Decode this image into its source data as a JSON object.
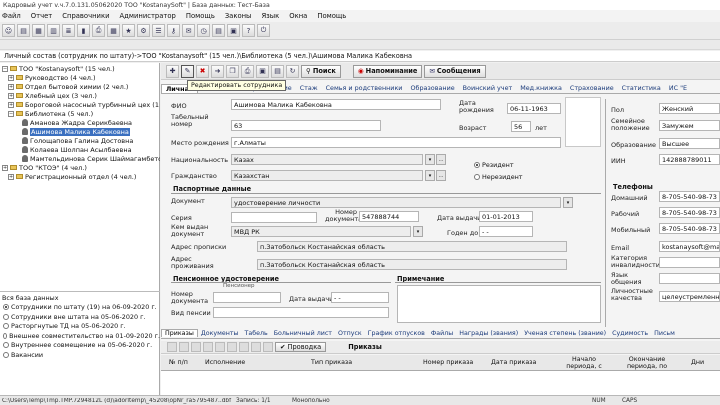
{
  "window": {
    "title": "Кадровый учет v.ч.7.0.131.05062020 ТОО \"KostanaySoft\" | База данных: Тест-База"
  },
  "menu": [
    "Файл",
    "Отчет",
    "Справочники",
    "Администратор",
    "Помощь",
    "Законы",
    "Язык",
    "Окна",
    "Помощь"
  ],
  "breadcrumb": "Личный состав (сотрудник по штату)->ТОО \"Kostanaysoft\" (15 чел.)\\Библиотека (5 чел.)\\Ашимова Малика Кабековна",
  "tree": {
    "items": [
      {
        "label": "ТОО \"Kostanaysoft\" (15 чел.)",
        "box": "−",
        "icon": "f"
      },
      {
        "label": "Руководство (4 чел.)",
        "box": "+",
        "icon": "f"
      },
      {
        "label": "Отдел бытовой химии (2 чел.)",
        "box": "+",
        "icon": "f"
      },
      {
        "label": "Хлебный цех (3 чел.)",
        "box": "+",
        "icon": "f"
      },
      {
        "label": "Бороговой насосный турбинный цех (1 чел.)",
        "box": "+",
        "icon": "f"
      },
      {
        "label": "Библиотека (5 чел.)",
        "box": "−",
        "icon": "f"
      },
      {
        "label": "Аманова Жадра Серикбаевна",
        "box": "",
        "icon": "p"
      },
      {
        "label": "Ашимова Малика Кабековна",
        "box": "",
        "icon": "p",
        "selected": true
      },
      {
        "label": "Голощапова Галина Достовна",
        "box": "",
        "icon": "p"
      },
      {
        "label": "Колаева Шолпан Асылбаевна",
        "box": "",
        "icon": "p"
      },
      {
        "label": "Мамтельдинова Серик Шаймагамбетович",
        "box": "",
        "icon": "p"
      },
      {
        "label": "ТОО \"КТОЭ\" (4 чел.)",
        "box": "+",
        "icon": "f"
      },
      {
        "label": "Регистрационный отдел (4 чел.)",
        "box": "+",
        "icon": "f"
      }
    ]
  },
  "filters": {
    "header": "Вся база данных",
    "options": [
      {
        "label": "Сотрудники по штату (19) на 06-09-2020 г.",
        "on": true
      },
      {
        "label": "Сотрудники вне штата на 05-06-2020 г.",
        "on": false
      },
      {
        "label": "Расторгнутые ТД на 05-06-2020 г.",
        "on": false
      },
      {
        "label": "Внешнее совместительство на 01-09-2020 г.",
        "on": false
      },
      {
        "label": "Внутреннее совмещение на 05-06-2020 г.",
        "on": false
      },
      {
        "label": "Вакансии",
        "on": false
      }
    ]
  },
  "toolbar": {
    "search": "Поиск",
    "reminder": "Напоминание",
    "messages": "Сообщения",
    "tooltip": "Редактировать сотрудника"
  },
  "tabs": [
    "Личная",
    "Перемещение",
    "Стаж",
    "Семья и родственники",
    "Образование",
    "Воинский учет",
    "Мед.книжка",
    "Страхование",
    "Статистика",
    "ИС \"Е"
  ],
  "person": {
    "fio_label": "ФИО",
    "fio": "Ашимова Малика Кабековна",
    "tabnum_label": "Табельный номер",
    "tabnum": "63",
    "birthdate_label": "Дата рождения",
    "birthdate": "06-11-1963",
    "age_label": "Возраст",
    "age": "56",
    "age_unit": "лет",
    "birthplace_label": "Место рождения",
    "birthplace": "г.Алматы",
    "nationality_label": "Национальность",
    "nationality": "Казах",
    "citizenship_label": "Гражданство",
    "citizenship": "Казахстан",
    "resident": "Резидент",
    "nonresident": "Нерезидент",
    "gender_label": "Пол",
    "gender": "Женский",
    "marital_label": "Семейное положение",
    "marital": "Замужем",
    "education_label": "Образование",
    "education": "Высшее",
    "iin_label": "ИИН",
    "iin": "142888789011"
  },
  "passport": {
    "header": "Паспортные данные",
    "doc_label": "Документ",
    "doc": "удостоверение личности",
    "series_label": "Серия",
    "number_label": "Номер документа",
    "number": "547888744",
    "issuedate_label": "Дата выдачи",
    "issuedate": "01-01-2013",
    "issuer_label": "Кем выдан документ",
    "issuer": "МВД РК",
    "valid_label": "Годен до",
    "valid": "- -",
    "reg_label": "Адрес прописки",
    "reg": "п.Затобольск Костанайская область",
    "live_label": "Адрес проживания",
    "live": "п.Затобольск Костанайская область"
  },
  "pension": {
    "header": "Пенсионное удостоверение",
    "sub": "Пенсионер",
    "number_label": "Номер документа",
    "date_label": "Дата выдачи",
    "date": "- -",
    "type_label": "Вид пенсии"
  },
  "note_header": "Примечание",
  "phones": {
    "header": "Телефоны",
    "home_label": "Домашний",
    "home": "8-705-540-98-73",
    "work_label": "Рабочий",
    "work": "8-705-540-98-73",
    "mobile_label": "Мобильный",
    "mobile": "8-705-540-98-73",
    "email_label": "Email",
    "email": "kostanaysoft@ma",
    "disability_label": "Категория инвалидности",
    "lang_label": "Язык общения",
    "quality_label": "Личностные качества",
    "quality": "целеустремленн"
  },
  "bottom_tabs": [
    "Приказы",
    "Документы",
    "Табель",
    "Больничный лист",
    "Отпуск",
    "График отпусков",
    "Файлы",
    "Награды (звания)",
    "Ученая степень (звание)",
    "Судимость",
    "Письм"
  ],
  "bottom_toolbar": {
    "save": "Проводка",
    "title": "Приказы"
  },
  "grid_headers": [
    "№ п/п",
    "Исполнение",
    "Тип приказа",
    "Номер приказа",
    "Дата приказа",
    "Начало периода, с",
    "Окончание периода, по",
    "Дни"
  ],
  "status": {
    "path": "C:\\Users\\Temp\\Tmp.TMP.7294812L (d)\\adorltemp\\_45208\\opNr_ra5795487..dbf",
    "record": "Запись: 1/1",
    "mode": "Монопольно",
    "num": "NUM",
    "caps": "CAPS"
  }
}
